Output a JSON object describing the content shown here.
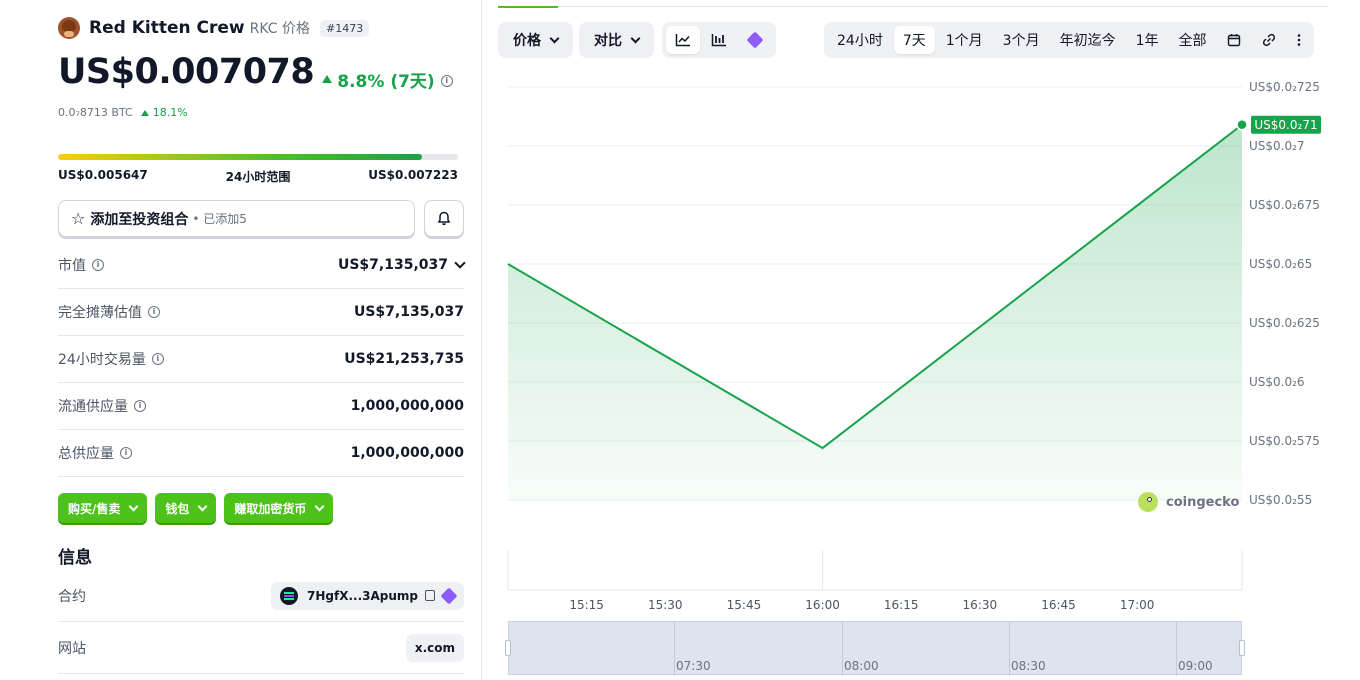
{
  "coin": {
    "name": "Red Kitten Crew",
    "symbol_label": "RKC 价格",
    "rank": "#1473",
    "price": "US$0.007078",
    "change_7d": "8.8% (7天)",
    "btc_price": "0.0₇8713 BTC",
    "btc_change": "18.1%"
  },
  "range_24h": {
    "low": "US$0.005647",
    "label": "24小时范围",
    "high": "US$0.007223",
    "position_pct": 91
  },
  "portfolio": {
    "label": "添加至投资组合",
    "added": "• 已添加5"
  },
  "stats": [
    {
      "label": "市值",
      "value": "US$7,135,037"
    },
    {
      "label": "完全摊薄估值",
      "value": "US$7,135,037"
    },
    {
      "label": "24小时交易量",
      "value": "US$21,253,735"
    },
    {
      "label": "流通供应量",
      "value": "1,000,000,000"
    },
    {
      "label": "总供应量",
      "value": "1,000,000,000"
    }
  ],
  "actions": [
    "购买/售卖",
    "钱包",
    "赚取加密货币"
  ],
  "info": {
    "title": "信息",
    "contract_label": "合约",
    "contract_value": "7HgfX...3Apump",
    "website_label": "网站",
    "website_value": "x.com"
  },
  "toolbar": {
    "price_btn": "价格",
    "compare_btn": "对比"
  },
  "time_ranges": [
    "24小时",
    "7天",
    "1个月",
    "3个月",
    "年初迄今",
    "1年",
    "全部"
  ],
  "active_range": "7天",
  "watermark": "coingecko",
  "colors": {
    "accent_green": "#4cc21a",
    "line_green": "#16a34a"
  },
  "chart_data": {
    "type": "area",
    "y_tick_labels": [
      "US$0.0₂725",
      "US$0.0₂7",
      "US$0.0₂675",
      "US$0.0₂65",
      "US$0.0₂625",
      "US$0.0₂6",
      "US$0.0₂575",
      "US$0.0₂55"
    ],
    "y_tick_values": [
      0.00725,
      0.007,
      0.00675,
      0.0065,
      0.00625,
      0.006,
      0.00575,
      0.0055
    ],
    "ylim": [
      0.0055,
      0.00725
    ],
    "x_tick_labels": [
      "15:15",
      "15:30",
      "15:45",
      "16:00",
      "16:15",
      "16:30",
      "16:45",
      "17:00"
    ],
    "x_tick_minutes": [
      915,
      930,
      945,
      960,
      975,
      990,
      1005,
      1020
    ],
    "xlim_minutes": [
      900,
      1040
    ],
    "points_minutes": [
      900,
      960,
      1040
    ],
    "points_values": [
      0.0065,
      0.00572,
      0.00709
    ],
    "current_label": "US$0.0₂71",
    "grid": true,
    "navigator": {
      "labels": [
        "07:30",
        "08:00",
        "08:30",
        "09:00"
      ]
    }
  }
}
